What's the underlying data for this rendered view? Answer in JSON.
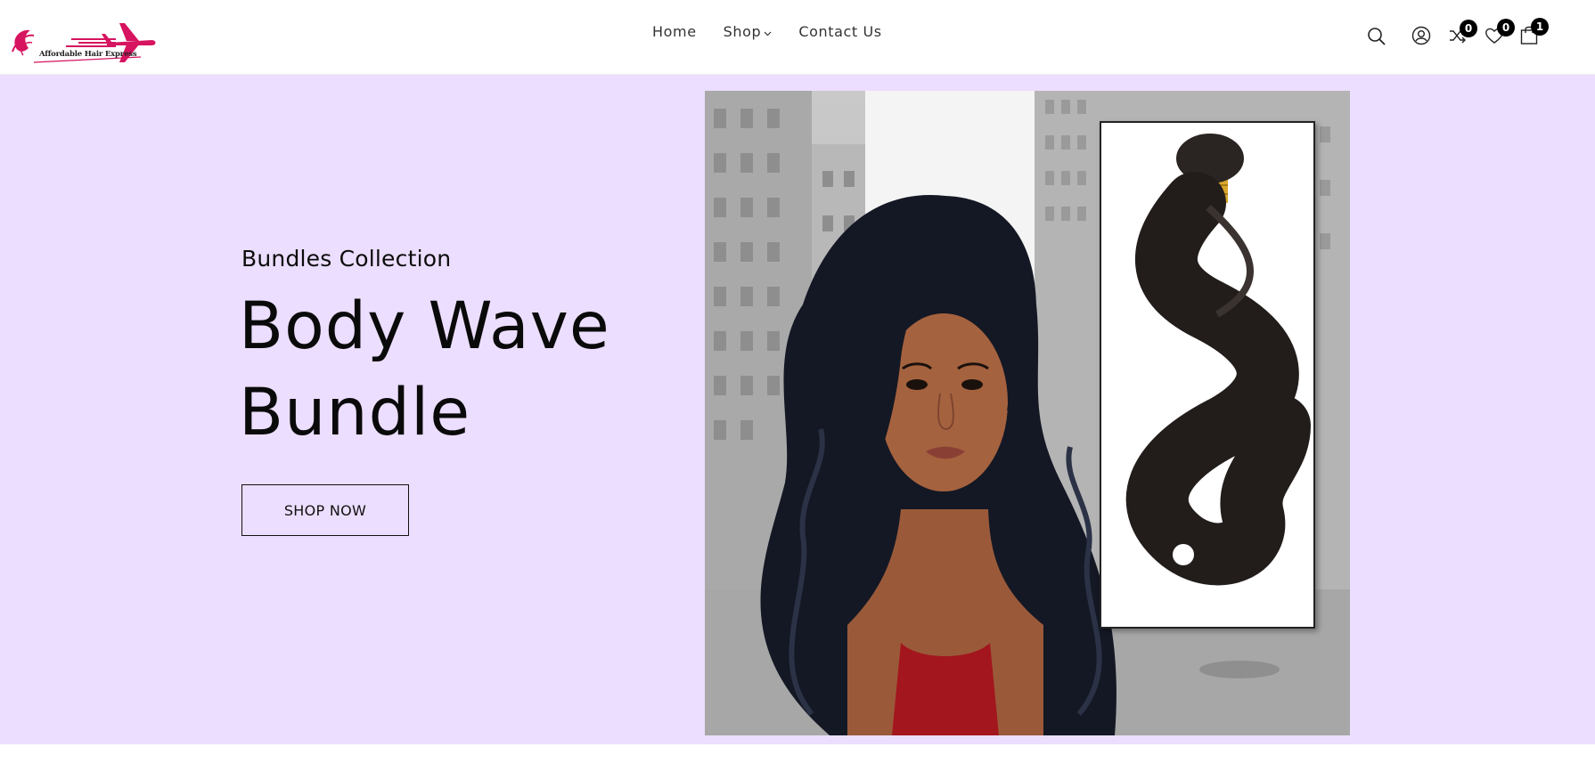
{
  "brand": {
    "name": "Affordable Hair Express",
    "accent": "#d6145f"
  },
  "nav": [
    {
      "label": "Home"
    },
    {
      "label": "Shop",
      "has_dropdown": true
    },
    {
      "label": "Contact Us"
    }
  ],
  "header_actions": {
    "search": {
      "icon": "search-icon"
    },
    "account": {
      "icon": "user-icon"
    },
    "compare": {
      "icon": "shuffle-icon",
      "count": "0"
    },
    "wishlist": {
      "icon": "heart-icon",
      "count": "0"
    },
    "cart": {
      "icon": "bag-icon",
      "count": "1"
    }
  },
  "hero": {
    "eyebrow": "Bundles Collection",
    "title": "Body Wave Bundle",
    "cta_label": "SHOP NOW",
    "background": "#ecdefe",
    "image_alt": "Woman with long body wave hair next to a body wave hair bundle"
  }
}
